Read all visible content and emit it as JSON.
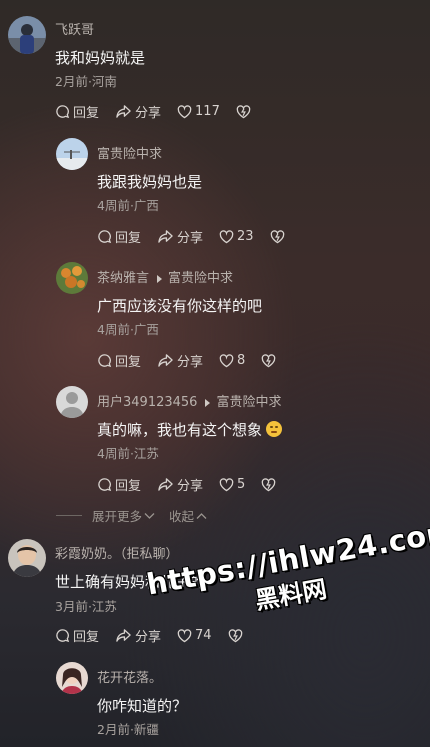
{
  "comments": [
    {
      "name": "飞跃哥",
      "text": "我和妈妈就是",
      "meta": "2月前·河南",
      "reply": "回复",
      "share": "分享",
      "likes": "117",
      "replies": [
        {
          "name": "富贵险中求",
          "reply_to": "",
          "text": "我跟我妈妈也是",
          "meta": "4周前·广西",
          "reply": "回复",
          "share": "分享",
          "likes": "23"
        },
        {
          "name": "茶纳雅言",
          "reply_to": "富贵险中求",
          "text": "广西应该没有你这样的吧",
          "meta": "4周前·广西",
          "reply": "回复",
          "share": "分享",
          "likes": "8"
        },
        {
          "name": "用户349123456",
          "reply_to": "富贵险中求",
          "text": "真的嘛，我也有这个想象",
          "meta": "4周前·江苏",
          "reply": "回复",
          "share": "分享",
          "likes": "5"
        }
      ],
      "expand": {
        "more": "展开更多",
        "collapse": "收起"
      }
    },
    {
      "name": "彩霞奶奶。（拒私聊）",
      "text": "世上确有妈妈和儿子的",
      "meta": "3月前·江苏",
      "reply": "回复",
      "share": "分享",
      "likes": "74",
      "replies": [
        {
          "name": "花开花落。",
          "reply_to": "",
          "text": "你咋知道的？",
          "meta": "2月前·新疆"
        }
      ]
    }
  ],
  "watermark": {
    "url": "https://ihlw24.com",
    "cn": "黑料网"
  },
  "icons": {
    "reply": "reply-bubble-icon",
    "share": "share-arrow-icon",
    "like": "heart-icon",
    "dislike": "broken-heart-icon",
    "emoji": "smirk-emoji-icon"
  }
}
